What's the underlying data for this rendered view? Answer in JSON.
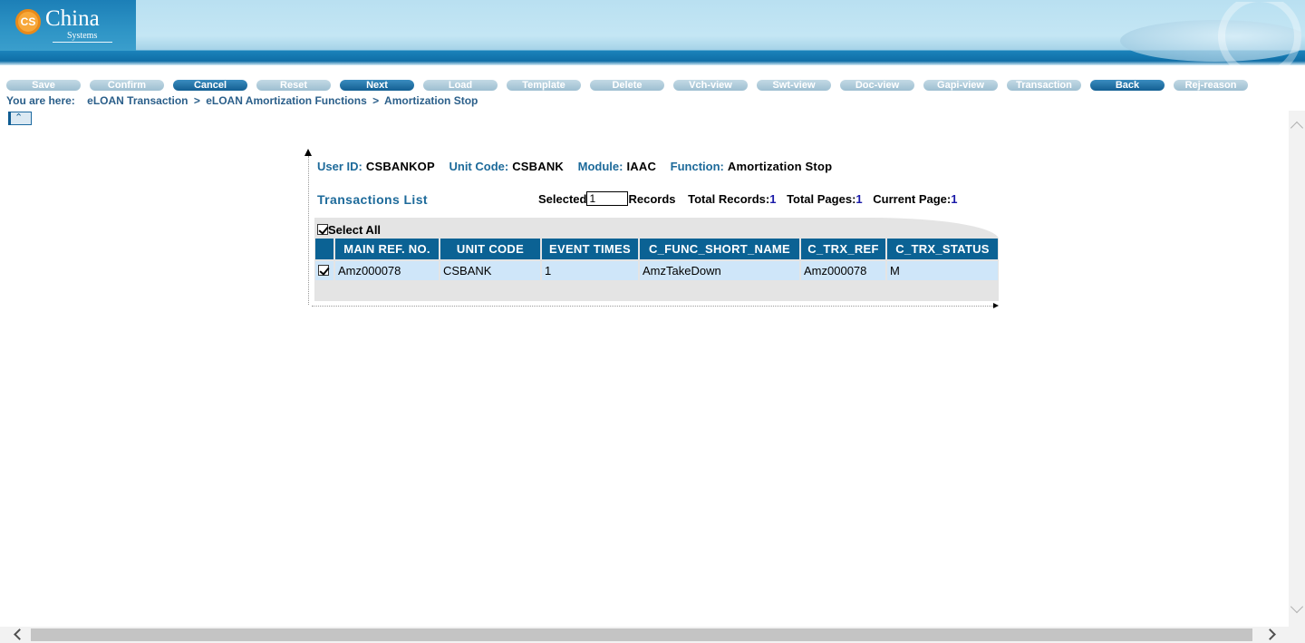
{
  "brand": {
    "mark": "CS",
    "name": "China",
    "sub": "Systems"
  },
  "toolbar": [
    {
      "label": "Save",
      "state": "disabled"
    },
    {
      "label": "Confirm",
      "state": "disabled"
    },
    {
      "label": "Cancel",
      "state": "enabled"
    },
    {
      "label": "Reset",
      "state": "disabled"
    },
    {
      "label": "Next",
      "state": "enabled"
    },
    {
      "label": "Load",
      "state": "disabled"
    },
    {
      "label": "Template",
      "state": "disabled"
    },
    {
      "label": "Delete",
      "state": "disabled"
    },
    {
      "label": "Vch-view",
      "state": "disabled"
    },
    {
      "label": "Swt-view",
      "state": "disabled"
    },
    {
      "label": "Doc-view",
      "state": "disabled"
    },
    {
      "label": "Gapi-view",
      "state": "disabled"
    },
    {
      "label": "Transaction",
      "state": "disabled"
    },
    {
      "label": "Back",
      "state": "enabled"
    },
    {
      "label": "Rej-reason",
      "state": "disabled"
    }
  ],
  "breadcrumb": {
    "prefix": "You are here:",
    "items": [
      "eLOAN Transaction",
      "eLOAN Amortization Functions",
      "Amortization Stop"
    ],
    "separator": ">"
  },
  "info": {
    "user_id_label": "User ID:",
    "user_id": "CSBANKOP",
    "unit_code_label": "Unit Code:",
    "unit_code": "CSBANK",
    "module_label": "Module:",
    "module": "IAAC",
    "function_label": "Function:",
    "function": "Amortization Stop"
  },
  "list": {
    "title": "Transactions List",
    "selected_label": "Selected",
    "selected_value": "1",
    "records_label": "Records",
    "total_records_label": "Total Records:",
    "total_records": "1",
    "total_pages_label": "Total Pages:",
    "total_pages": "1",
    "current_page_label": "Current Page:",
    "current_page": "1",
    "select_all_label": "Select All",
    "select_all_checked": true,
    "columns": [
      "MAIN REF. NO.",
      "UNIT CODE",
      "EVENT TIMES",
      "C_FUNC_SHORT_NAME",
      "C_TRX_REF",
      "C_TRX_STATUS"
    ],
    "rows": [
      {
        "checked": true,
        "cells": [
          "Amz000078",
          "CSBANK",
          "1",
          "AmzTakeDown",
          "Amz000078",
          "M"
        ]
      }
    ]
  },
  "colors": {
    "header_blue": "#0b6294",
    "label_blue": "#1d6a9a",
    "row_bg": "#cfe6f9",
    "number_blue": "#1a1aa8"
  }
}
